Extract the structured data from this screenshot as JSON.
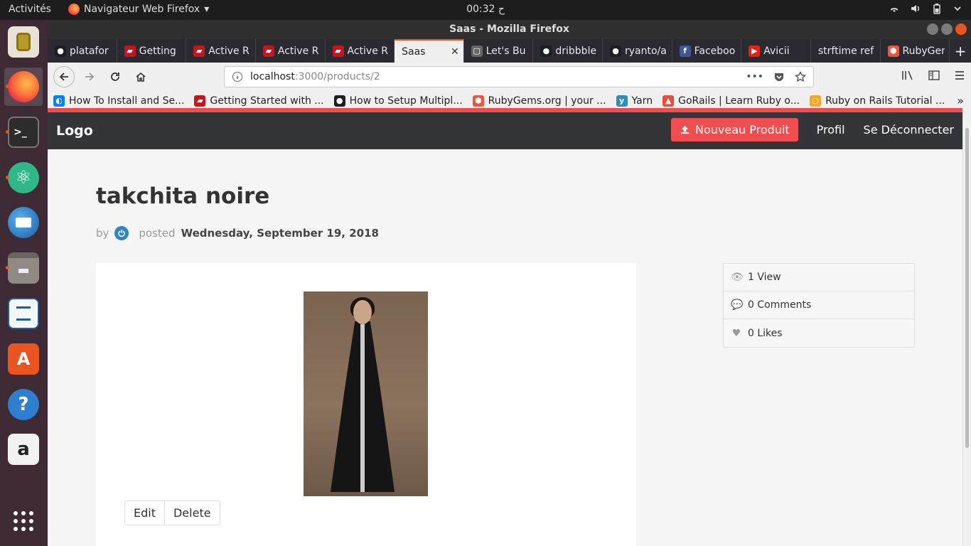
{
  "topbar": {
    "activities": "Activités",
    "app_menu": "Navigateur Web Firefox",
    "app_menu_caret": "▾",
    "clock": "ح 00:32",
    "tray_icons": [
      "wifi-icon",
      "volume-icon",
      "battery-icon",
      "power-menu-icon"
    ]
  },
  "dock": {
    "items": [
      "rhythmbox",
      "firefox",
      "terminal",
      "atom",
      "thunderbird",
      "files",
      "libreoffice-writer",
      "software-center",
      "help",
      "amazon",
      "show-applications"
    ]
  },
  "window": {
    "title": "Saas - Mozilla Firefox"
  },
  "tabs": [
    {
      "label": "platafor",
      "icon": "github"
    },
    {
      "label": "Getting",
      "icon": "rails"
    },
    {
      "label": "Active R",
      "icon": "rails"
    },
    {
      "label": "Active R",
      "icon": "rails"
    },
    {
      "label": "Active R",
      "icon": "rails"
    },
    {
      "label": "Saas",
      "icon": "none",
      "selected": true,
      "close": "✕"
    },
    {
      "label": "Let's Bu",
      "icon": "page"
    },
    {
      "label": "dribbble",
      "icon": "github"
    },
    {
      "label": "ryanto/a",
      "icon": "github"
    },
    {
      "label": "Faceboo",
      "icon": "facebook"
    },
    {
      "label": "Avicii",
      "icon": "youtube"
    },
    {
      "label": "strftime ref",
      "icon": "none"
    },
    {
      "label": "RubyGer",
      "icon": "rubygems"
    }
  ],
  "newtab_label": "+",
  "nav": {
    "url_host": "localhost",
    "url_path": ":3000/products/2",
    "page_actions": "•••"
  },
  "bookmarks": [
    {
      "label": "How To Install and Se...",
      "icon": "digitalocean"
    },
    {
      "label": "Getting Started with ...",
      "icon": "rails"
    },
    {
      "label": "How to Setup Multipl...",
      "icon": "github"
    },
    {
      "label": "RubyGems.org | your ...",
      "icon": "rubygems"
    },
    {
      "label": "Yarn",
      "icon": "yarn"
    },
    {
      "label": "GoRails | Learn Ruby o...",
      "icon": "gorails"
    },
    {
      "label": "Ruby on Rails Tutorial ...",
      "icon": "ring"
    }
  ],
  "bookmarks_more": "»",
  "app": {
    "brand": "Logo",
    "new_product": "Nouveau Produit",
    "profile": "Profil",
    "logout": "Se Déconnecter"
  },
  "product": {
    "title": "takchita noire",
    "by": "by",
    "posted": "posted",
    "date": "Wednesday, September 19, 2018",
    "edit": "Edit",
    "delete": "Delete"
  },
  "stats": [
    {
      "label": "1 View",
      "icon": "eye-icon"
    },
    {
      "label": "0 Comments",
      "icon": "comment-icon"
    },
    {
      "label": "0 Likes",
      "icon": "heart-icon"
    }
  ],
  "colors": {
    "accent": "#f04e4e",
    "navbar": "#333538",
    "dock": "#3d2a35"
  }
}
